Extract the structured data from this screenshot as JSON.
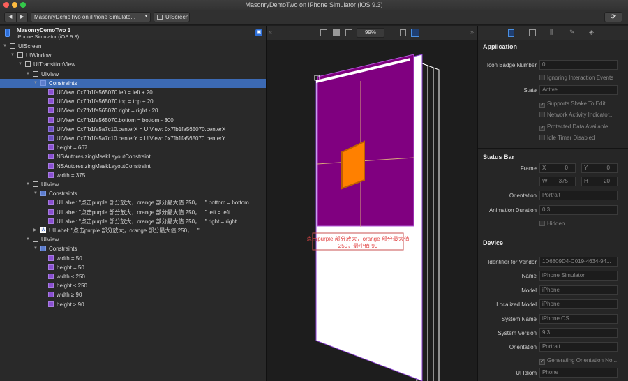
{
  "window": {
    "title": "MasonryDemoTwo on iPhone Simulator (iOS 9.3)"
  },
  "toolbar": {
    "target": "MasonryDemoTwo on iPhone Simulato...",
    "breadcrumb": "UIScreen"
  },
  "navigator": {
    "process_name": "MasonryDemoTwo 1",
    "process_sub": "iPhone Simulator (iOS 9.3)",
    "rows": [
      {
        "t": "UIScreen"
      },
      {
        "t": "UIWindow"
      },
      {
        "t": "UITransitionView"
      },
      {
        "t": "UIView"
      },
      {
        "t": "Constraints"
      },
      {
        "t": "UIView: 0x7fb1fa565070.left = left + 20"
      },
      {
        "t": "UIView: 0x7fb1fa565070.top = top + 20"
      },
      {
        "t": "UIView: 0x7fb1fa565070.right = right - 20"
      },
      {
        "t": "UIView: 0x7fb1fa565070.bottom = bottom - 300"
      },
      {
        "t": "UIView: 0x7fb1fa5a7c10.centerX = UIView: 0x7fb1fa565070.centerX"
      },
      {
        "t": "UIView: 0x7fb1fa5a7c10.centerY = UIView: 0x7fb1fa565070.centerY"
      },
      {
        "t": "height = 667"
      },
      {
        "t": "NSAutoresizingMaskLayoutConstraint"
      },
      {
        "t": "NSAutoresizingMaskLayoutConstraint"
      },
      {
        "t": "width = 375"
      },
      {
        "t": "UIView"
      },
      {
        "t": "Constraints"
      },
      {
        "t": "UILabel: \"点击purple 部分放大，orange 部分最大值 250，...\".bottom = bottom"
      },
      {
        "t": "UILabel: \"点击purple 部分放大，orange 部分最大值 250，...\".left = left"
      },
      {
        "t": "UILabel: \"点击purple 部分放大，orange 部分最大值 250，...\".right = right"
      },
      {
        "t": "UILabel: \"点击purple 部分放大，orange 部分最大值 250，...\""
      },
      {
        "t": "UIView"
      },
      {
        "t": "Constraints"
      },
      {
        "t": "width = 50"
      },
      {
        "t": "height = 50"
      },
      {
        "t": "width ≤ 250"
      },
      {
        "t": "height ≤ 250"
      },
      {
        "t": "width ≥ 90"
      },
      {
        "t": "height ≥ 90"
      }
    ]
  },
  "canvas": {
    "zoom": "99%",
    "label_text": "点击purple 部分放大，orange 部分最大值 250，最小值 90"
  },
  "inspector": {
    "application": {
      "title": "Application",
      "icon_badge_label": "Icon Badge Number",
      "icon_badge_value": "0",
      "ignoring_events": "Ignoring Interaction Events",
      "state_label": "State",
      "state_value": "Active",
      "shake": "Supports Shake To Edit",
      "network": "Network Activity Indicator...",
      "protected": "Protected Data Available",
      "idle": "Idle Timer Disabled"
    },
    "status_bar": {
      "title": "Status Bar",
      "frame_label": "Frame",
      "x_label": "X",
      "x_value": "0",
      "y_label": "Y",
      "y_value": "0",
      "w_label": "W",
      "w_value": "375",
      "h_label": "H",
      "h_value": "20",
      "orientation_label": "Orientation",
      "orientation_value": "Portrait",
      "anim_label": "Animation Duration",
      "anim_value": "0.3",
      "hidden": "Hidden"
    },
    "device": {
      "title": "Device",
      "vendor_label": "Identifier for Vendor",
      "vendor_value": "1D6809D4-C019-4634-94...",
      "name_label": "Name",
      "name_value": "iPhone Simulator",
      "model_label": "Model",
      "model_value": "iPhone",
      "lmodel_label": "Localized Model",
      "lmodel_value": "iPhone",
      "sysname_label": "System Name",
      "sysname_value": "iPhone OS",
      "sysver_label": "System Version",
      "sysver_value": "9.3",
      "orient_label": "Orientation",
      "orient_value": "Portrait",
      "gen_orient": "Generating Orientation No...",
      "idiom_label": "UI Idiom",
      "idiom_value": "Phone"
    }
  },
  "colors": {
    "purple": "#800080",
    "orange": "#ff8000",
    "selection": "#3c6ab4"
  }
}
